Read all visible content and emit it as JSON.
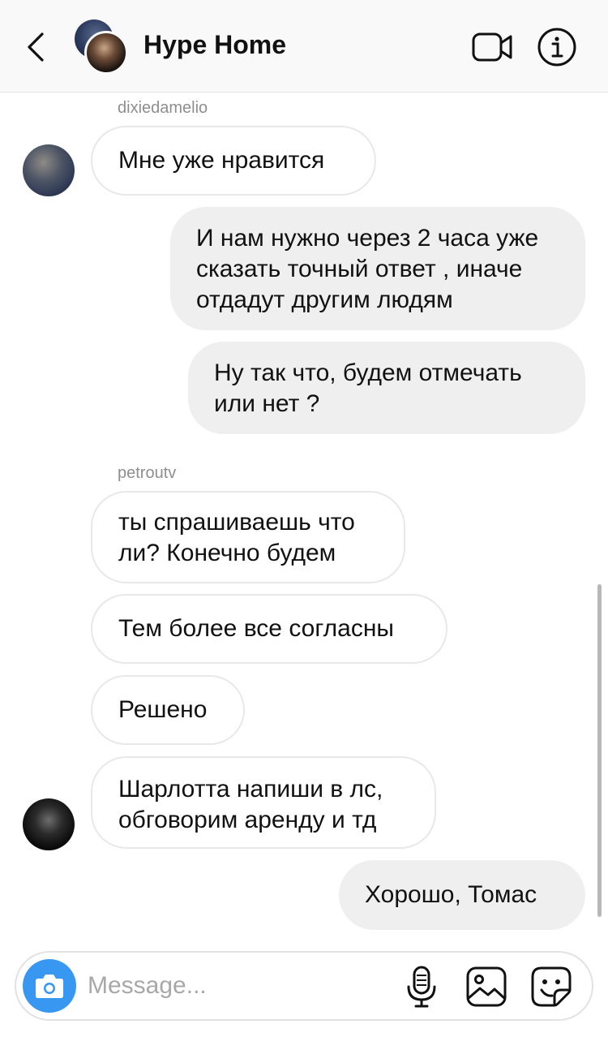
{
  "header": {
    "title": "Hype Home",
    "back_icon": "chevron-left-icon",
    "video_icon": "video-camera-icon",
    "info_icon": "info-icon"
  },
  "thread": {
    "groups": [
      {
        "sender": "dixiedamelio",
        "messages": [
          "Мне уже нравится"
        ]
      },
      {
        "sender": "me",
        "messages": [
          "И нам нужно через 2 часа уже сказать точный ответ , иначе отдадут другим людям",
          "Ну так что, будем отмечать или нет ?"
        ]
      },
      {
        "sender": "petroutv",
        "messages": [
          "ты спрашиваешь что ли? Конечно будем",
          "Тем более все согласны",
          "Решено",
          "Шарлотта напиши в лс, обговорим аренду и тд"
        ]
      },
      {
        "sender": "me",
        "messages": [
          "Хорошо, Томас"
        ]
      }
    ]
  },
  "composer": {
    "placeholder": "Message...",
    "camera_icon": "camera-icon",
    "mic_icon": "microphone-icon",
    "gallery_icon": "gallery-icon",
    "sticker_icon": "sticker-icon"
  },
  "colors": {
    "accent": "#3897f0",
    "outgoing_bubble": "#efefef",
    "incoming_border": "#e8e8e8",
    "sender_label": "#8e8e8e"
  }
}
